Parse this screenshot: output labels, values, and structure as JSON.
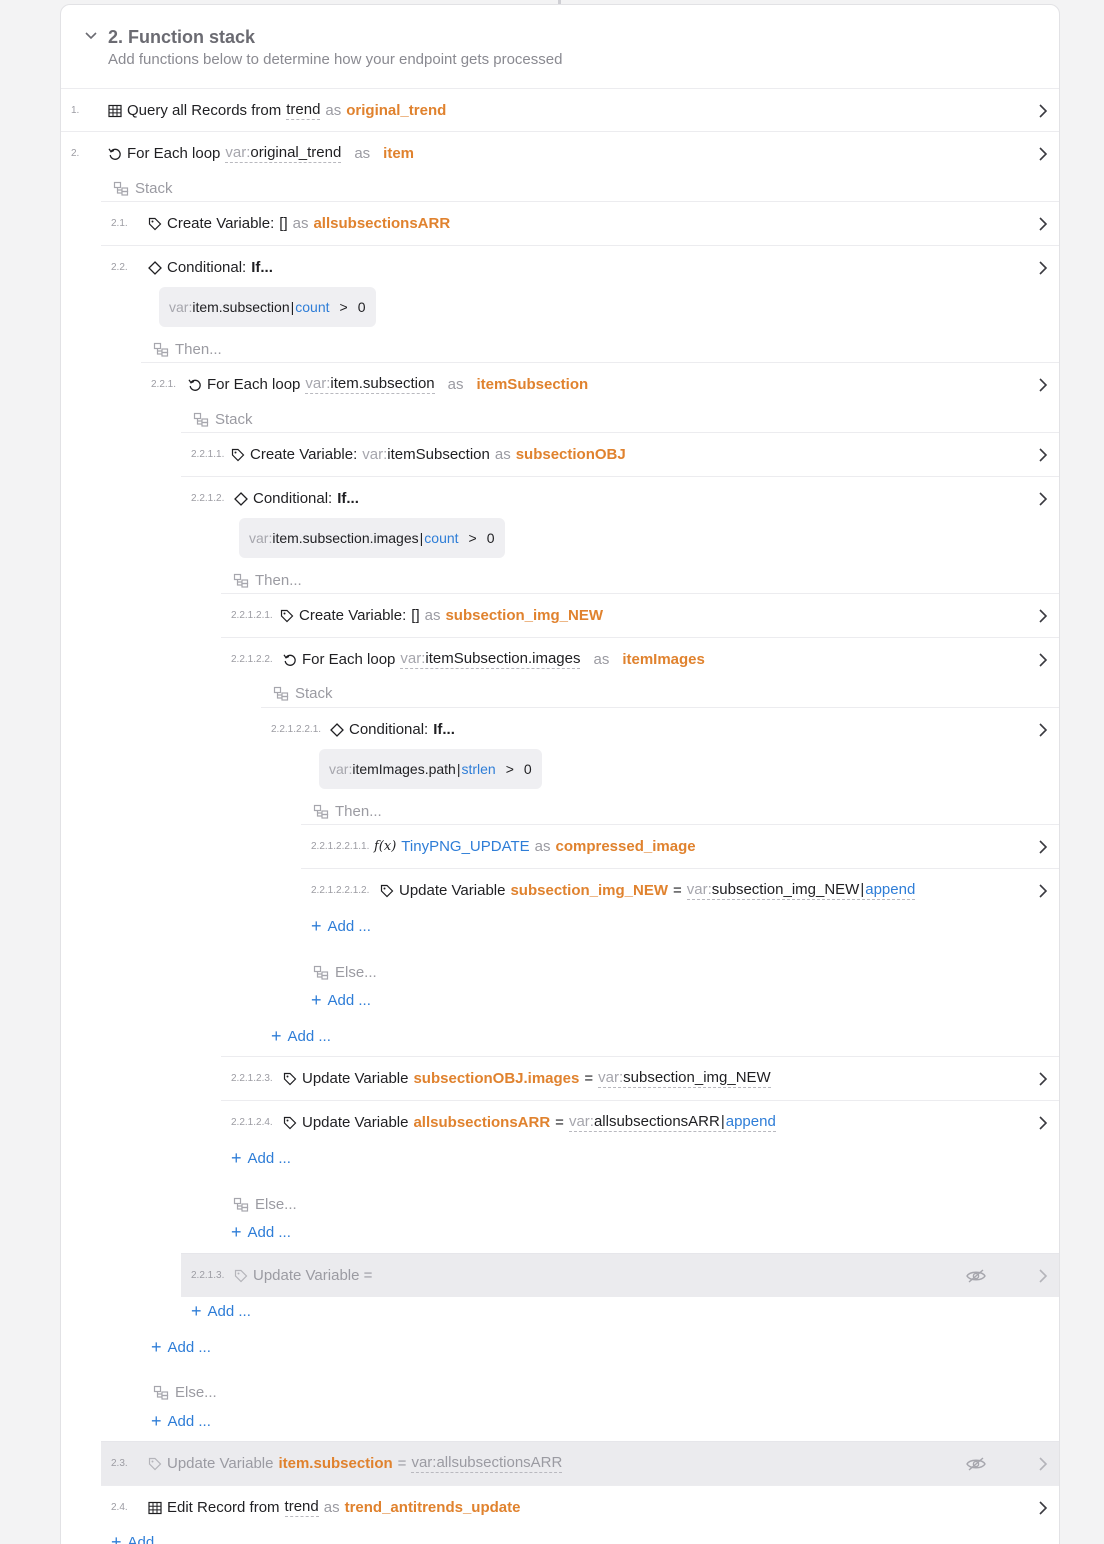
{
  "section": {
    "title": "2. Function stack",
    "subtitle": "Add functions below to determine how your endpoint gets processed"
  },
  "words": {
    "as": "as",
    "var": "var:",
    "stack": "Stack",
    "then": "Then...",
    "else": "Else...",
    "add": "Add ...",
    "if": "If...",
    "conditional": "Conditional:",
    "for_each": "For Each loop",
    "create_variable": "Create Variable:",
    "update_variable": "Update Variable",
    "eq": "=",
    "gt": ">",
    "count": "count",
    "strlen": "strlen",
    "append": "append",
    "empty_arr": "[]"
  },
  "rows": {
    "r1": {
      "num": "1.",
      "lead": "Query all Records from",
      "table": "trend",
      "alias": "original_trend"
    },
    "r2": {
      "num": "2.",
      "source": "original_trend",
      "alias": "item"
    },
    "r2_1": {
      "num": "2.1.",
      "alias": "allsubsectionsARR"
    },
    "r2_2": {
      "num": "2.2.",
      "cond_var": "item.subsection",
      "cond_val": "0"
    },
    "r2_2_1": {
      "num": "2.2.1.",
      "source": "item.subsection",
      "alias": "itemSubsection"
    },
    "r2_2_1_1": {
      "num": "2.2.1.1.",
      "source": "itemSubsection",
      "alias": "subsectionOBJ"
    },
    "r2_2_1_2": {
      "num": "2.2.1.2.",
      "cond_var": "item.subsection.images",
      "cond_val": "0"
    },
    "r2_2_1_2_1": {
      "num": "2.2.1.2.1.",
      "alias": "subsection_img_NEW"
    },
    "r2_2_1_2_2": {
      "num": "2.2.1.2.2.",
      "source": "itemSubsection.images",
      "alias": "itemImages"
    },
    "r2_2_1_2_2_1": {
      "num": "2.2.1.2.2.1.",
      "cond_var": "itemImages.path",
      "cond_val": "0"
    },
    "r2_2_1_2_2_1_1": {
      "num": "2.2.1.2.2.1.1.",
      "func": "TinyPNG_UPDATE",
      "alias": "compressed_image"
    },
    "r2_2_1_2_2_1_2": {
      "num": "2.2.1.2.2.1.2.",
      "target": "subsection_img_NEW",
      "source": "subsection_img_NEW"
    },
    "r2_2_1_2_3": {
      "num": "2.2.1.2.3.",
      "target": "subsectionOBJ.images",
      "source": "subsection_img_NEW"
    },
    "r2_2_1_2_4": {
      "num": "2.2.1.2.4.",
      "target": "allsubsectionsARR",
      "source": "allsubsectionsARR"
    },
    "r2_2_1_3": {
      "num": "2.2.1.3.",
      "label": "Update Variable ="
    },
    "r2_3": {
      "num": "2.3.",
      "target": "item.subsection",
      "source": "allsubsectionsARR"
    },
    "r2_4": {
      "num": "2.4.",
      "lead": "Edit Record from",
      "table": "trend",
      "alias": "trend_antitrends_update"
    }
  },
  "footer_add": "Add",
  "colors": {
    "accent_orange": "#e0822e",
    "link_blue": "#2e7dd7",
    "muted": "#9b9ba2"
  }
}
